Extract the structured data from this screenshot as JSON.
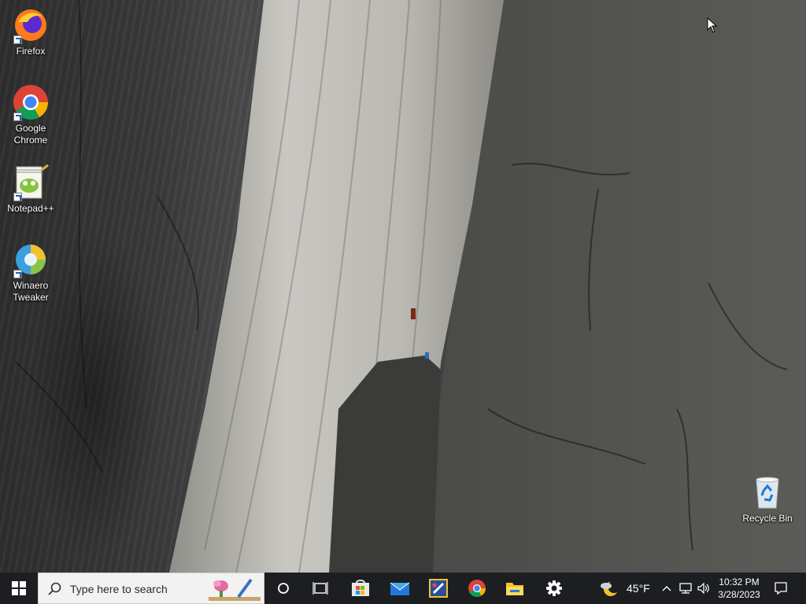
{
  "desktop": {
    "icons": [
      {
        "label": "Firefox"
      },
      {
        "label": "Google\nChrome"
      },
      {
        "label": "Notepad++"
      },
      {
        "label": "Winaero\nTweaker"
      },
      {
        "label": "Recycle Bin"
      }
    ]
  },
  "taskbar": {
    "search_placeholder": "Type here to search",
    "weather": {
      "temperature": "45°F"
    },
    "clock": {
      "time": "10:32 PM",
      "date": "3/28/2023"
    },
    "pinned": [
      "start-icon",
      "cortana-icon",
      "task-view-icon",
      "microsoft-store-icon",
      "mail-icon",
      "paint-app-icon",
      "chrome-icon",
      "file-explorer-icon",
      "settings-icon"
    ],
    "tray": [
      "chevron-up-icon",
      "network-icon",
      "volume-icon",
      "notifications-icon"
    ]
  }
}
